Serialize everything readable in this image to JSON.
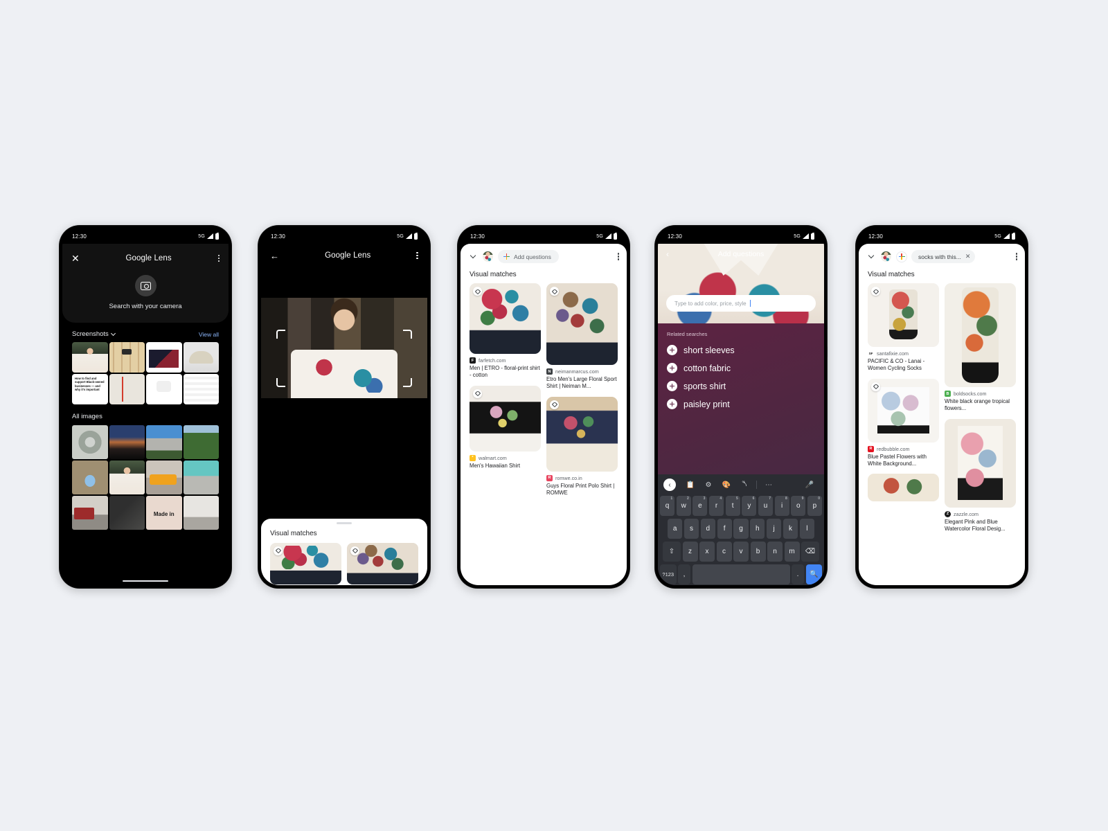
{
  "meta": {
    "background_color": "#eef0f4",
    "accent_blue": "#4285f4",
    "link_blue": "#8ab4f8"
  },
  "status_bar": {
    "time": "12:30",
    "network": "5G",
    "signal_icon": "signal-bars-icon",
    "battery_icon": "battery-full-icon"
  },
  "phone1": {
    "appbar": {
      "close_icon": "close-icon",
      "title_g": "Google",
      "title_lens": "Lens",
      "overflow_icon": "more-vert-icon"
    },
    "camera": {
      "icon": "camera-search-icon",
      "label": "Search with your camera"
    },
    "screenshots_section": {
      "title": "Screenshots",
      "chevron_icon": "chevron-down-icon",
      "view_all": "View all",
      "items": [
        {
          "name": "floral-shirt-man",
          "alt": "Man in floral print shirt"
        },
        {
          "name": "plaid-jacket",
          "alt": "Plaid flannel jacket"
        },
        {
          "name": "news-article",
          "alt": "Article with product photos"
        },
        {
          "name": "beige-cap",
          "alt": "Beige baseball cap"
        },
        {
          "name": "blog-post",
          "alt": "How to find and support Black-owned businesses — and why it's important"
        },
        {
          "name": "map-route",
          "alt": "Map with driving route"
        },
        {
          "name": "white-tshirt",
          "alt": "White t-shirt listing $60"
        },
        {
          "name": "stock-table",
          "alt": "Stock price table"
        }
      ]
    },
    "all_images_section": {
      "title": "All images",
      "items": [
        {
          "name": "spiral-staircase"
        },
        {
          "name": "dusk-mountains"
        },
        {
          "name": "half-dome"
        },
        {
          "name": "valley-tree"
        },
        {
          "name": "stone-archway"
        },
        {
          "name": "floral-shirt-portrait"
        },
        {
          "name": "school-bus"
        },
        {
          "name": "glacier-ice"
        },
        {
          "name": "cable-car"
        },
        {
          "name": "aerial-city"
        },
        {
          "name": "made-in-sign"
        },
        {
          "name": "storefront"
        }
      ]
    },
    "home_indicator": "home-indicator"
  },
  "phone2": {
    "appbar": {
      "back_icon": "back-arrow-icon",
      "title_g": "Google",
      "title_lens": "Lens",
      "overflow_icon": "more-vert-icon"
    },
    "viewfinder": {
      "crop_frame": "crop-frame",
      "subject": "Man wearing white floral print shirt"
    },
    "sheet": {
      "grabber": "drag-handle",
      "title": "Visual matches",
      "cards": [
        {
          "name": "match-red-floral-shirt"
        },
        {
          "name": "match-beige-floral-shirt"
        }
      ]
    }
  },
  "phone3": {
    "bar": {
      "collapse_icon": "chevron-down-icon",
      "avatar": "source-image-thumbnail",
      "add_questions_label": "Add questions",
      "plus_icon": "google-plus-icon",
      "overflow_icon": "more-vert-icon"
    },
    "heading": "Visual matches",
    "results": [
      {
        "source": "farfetch.com",
        "favicon": "farfetch-icon",
        "favicon_color": "#1a1a1a",
        "favicon_letter": "F",
        "title": "Men | ETRO - floral-print shirt - cotton",
        "image": "red-floral-shirt",
        "tag_icon": "product-tag-icon"
      },
      {
        "source": "neimanmarcus.com",
        "favicon": "neimanmarcus-icon",
        "favicon_color": "#3c4043",
        "favicon_letter": "N",
        "title": "Etro Men's Large Floral Sport Shirt | Neiman M...",
        "image": "beige-floral-shirt",
        "tag_icon": "product-tag-icon"
      },
      {
        "source": "walmart.com",
        "favicon": "walmart-icon",
        "favicon_color": "#ffc220",
        "favicon_letter": "*",
        "title": "Men's Hawaiian Shirt",
        "image": "black-floral-shirt",
        "tag_icon": "product-tag-icon"
      },
      {
        "source": "romwe.co.in",
        "favicon": "romwe-icon",
        "favicon_color": "#e8455f",
        "favicon_letter": "R",
        "title": "Guys Floral Print Polo Shirt | ROMWE",
        "image": "navy-floral-polo",
        "tag_icon": "product-tag-icon"
      }
    ]
  },
  "phone4": {
    "bar": {
      "back_icon": "back-chevron-icon",
      "title": "Add questions"
    },
    "input": {
      "placeholder": "Type to add color, price, style",
      "value": "",
      "caret": "text-caret"
    },
    "related": {
      "label": "Related searches",
      "items": [
        {
          "label": "short sleeves",
          "icon": "plus-icon"
        },
        {
          "label": "cotton fabric",
          "icon": "plus-icon"
        },
        {
          "label": "sports shirt",
          "icon": "plus-icon"
        },
        {
          "label": "paisley print",
          "icon": "plus-icon"
        }
      ]
    },
    "keyboard": {
      "toolbar": [
        {
          "name": "collapse-toolbar-icon",
          "glyph": "‹"
        },
        {
          "name": "clipboard-icon",
          "glyph": "ὌB"
        },
        {
          "name": "settings-gear-icon",
          "glyph": "⚙"
        },
        {
          "name": "theme-palette-icon",
          "glyph": "Ἲ8"
        },
        {
          "name": "one-hand-mode-icon",
          "glyph": "⬒"
        },
        {
          "name": "more-options-icon",
          "glyph": "⋯"
        },
        {
          "name": "microphone-icon",
          "glyph": "Ἲ4"
        }
      ],
      "row1": [
        {
          "key": "q",
          "num": "1"
        },
        {
          "key": "w",
          "num": "2"
        },
        {
          "key": "e",
          "num": "3"
        },
        {
          "key": "r",
          "num": "4"
        },
        {
          "key": "t",
          "num": "5"
        },
        {
          "key": "y",
          "num": "6"
        },
        {
          "key": "u",
          "num": "7"
        },
        {
          "key": "i",
          "num": "8"
        },
        {
          "key": "o",
          "num": "9"
        },
        {
          "key": "p",
          "num": "0"
        }
      ],
      "row2": [
        "a",
        "s",
        "d",
        "f",
        "g",
        "h",
        "j",
        "k",
        "l"
      ],
      "row3_shift": "shift-icon",
      "row3": [
        "z",
        "x",
        "c",
        "v",
        "b",
        "n",
        "m"
      ],
      "row3_backspace": "backspace-icon",
      "row4_sym": "?123",
      "row4_comma": ",",
      "row4_space": "",
      "row4_dot": ".",
      "row4_go": "search-icon"
    }
  },
  "phone5": {
    "bar": {
      "collapse_icon": "chevron-down-icon",
      "avatar": "source-image-thumbnail",
      "plus_icon": "google-plus-icon",
      "query_chip": "socks with this...",
      "chip_clear_icon": "close-icon",
      "overflow_icon": "more-vert-icon"
    },
    "heading": "Visual matches",
    "results": [
      {
        "source": "santafixie.com",
        "favicon": "santafixie-icon",
        "favicon_color": "#ffffff",
        "favicon_letter": "SF",
        "title": "PACIFIC & CO - Lanai - Women Cycling Socks",
        "image": "floral-cycling-sock",
        "tag_icon": "product-tag-icon"
      },
      {
        "source": "boldsocks.com",
        "favicon": "boldsocks-icon",
        "favicon_color": "#4caf50",
        "favicon_letter": "B",
        "title": "White black orange tropical flowers...",
        "image": "tropical-flower-sock",
        "tag_icon": "product-tag-icon"
      },
      {
        "source": "redbubble.com",
        "favicon": "redbubble-icon",
        "favicon_color": "#e41321",
        "favicon_letter": "R",
        "title": "Blue Pastel Flowers with White Background...",
        "image": "pastel-flower-socks",
        "tag_icon": "product-tag-icon"
      },
      {
        "source": "zazzle.com",
        "favicon": "zazzle-icon",
        "favicon_color": "#1a1a1a",
        "favicon_letter": "Z",
        "title": "Elegant Pink and Blue Watercolor Floral Desig...",
        "image": "pink-blue-floral-socks",
        "tag_icon": "product-tag-icon"
      }
    ]
  }
}
